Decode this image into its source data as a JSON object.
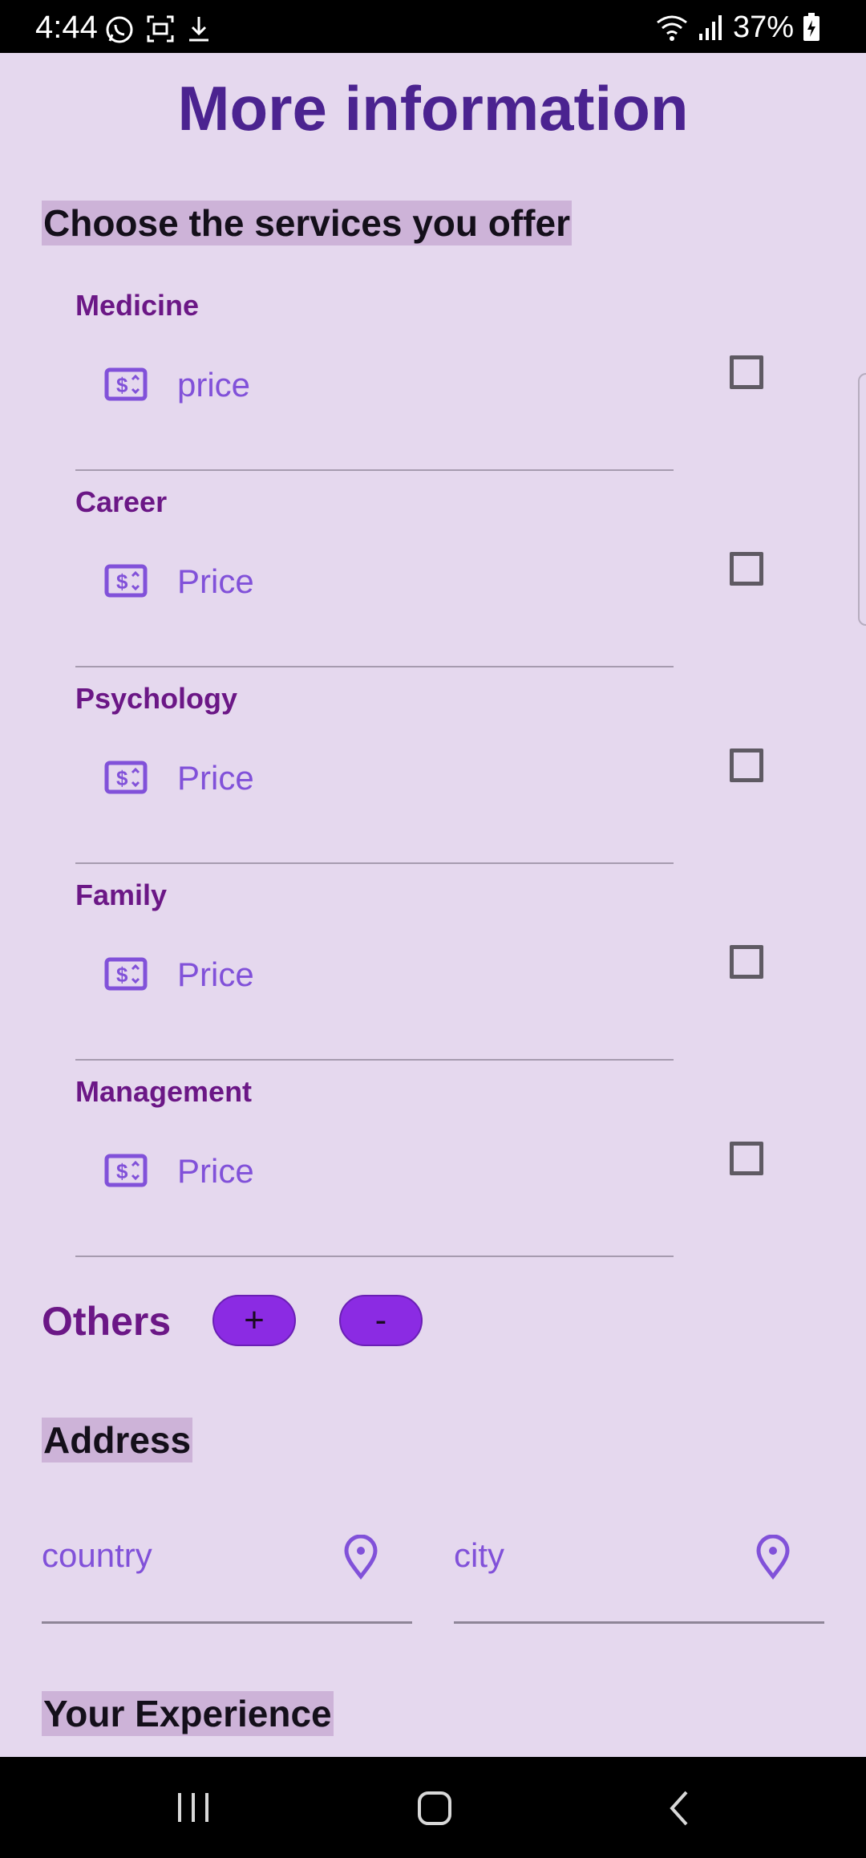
{
  "status_bar": {
    "time": "4:44",
    "battery": "37%",
    "icons_left": [
      "whatsapp-icon",
      "screen-record-icon",
      "download-icon"
    ],
    "icons_right": [
      "wifi-icon",
      "signal-icon",
      "battery-charging-icon"
    ]
  },
  "page": {
    "title": "More information"
  },
  "services": {
    "heading": "Choose the services you offer",
    "items": [
      {
        "name": "Medicine",
        "price_placeholder": "price",
        "checked": false
      },
      {
        "name": "Career",
        "price_placeholder": "Price",
        "checked": false
      },
      {
        "name": "Psychology",
        "price_placeholder": "Price",
        "checked": false
      },
      {
        "name": "Family",
        "price_placeholder": "Price",
        "checked": false
      },
      {
        "name": "Management",
        "price_placeholder": "Price",
        "checked": false
      }
    ]
  },
  "others": {
    "label": "Others",
    "add_label": "+",
    "remove_label": "-"
  },
  "address": {
    "heading": "Address",
    "country_placeholder": "country",
    "city_placeholder": "city"
  },
  "experience": {
    "heading": "Your Experience"
  },
  "colors": {
    "background": "#E5D8EE",
    "title": "#4B2390",
    "label": "#6B1786",
    "hint": "#8151D9",
    "button": "#8B2BE3",
    "heading_highlight": "#CDB3D8"
  }
}
